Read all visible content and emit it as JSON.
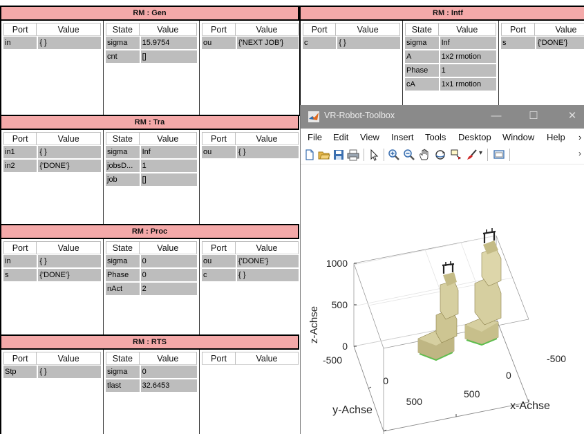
{
  "blocks": {
    "gen": {
      "title": "RM : Gen",
      "inputs": {
        "headers": [
          "Port",
          "Value"
        ],
        "rows": [
          [
            "in",
            "{ }"
          ]
        ]
      },
      "states": {
        "headers": [
          "State",
          "Value"
        ],
        "rows": [
          [
            "sigma",
            "15.9754"
          ],
          [
            "cnt",
            "[]"
          ]
        ]
      },
      "outputs": {
        "headers": [
          "Port",
          "Value"
        ],
        "rows": [
          [
            "ou",
            "{'NEXT JOB'}"
          ]
        ]
      }
    },
    "intf": {
      "title": "RM : Intf",
      "inputs": {
        "headers": [
          "Port",
          "Value"
        ],
        "rows": [
          [
            "c",
            "{ }"
          ]
        ]
      },
      "states": {
        "headers": [
          "State",
          "Value"
        ],
        "rows": [
          [
            "sigma",
            "Inf"
          ],
          [
            "A",
            "1x2 rmotion"
          ],
          [
            "Phase",
            "1"
          ],
          [
            "cA",
            "1x1 rmotion"
          ]
        ]
      },
      "outputs": {
        "headers": [
          "Port",
          "Value"
        ],
        "rows": [
          [
            "s",
            "{'DONE'}"
          ]
        ]
      }
    },
    "tra": {
      "title": "RM : Tra",
      "inputs": {
        "headers": [
          "Port",
          "Value"
        ],
        "rows": [
          [
            "in1",
            "{ }"
          ],
          [
            "in2",
            "{'DONE'}"
          ]
        ]
      },
      "states": {
        "headers": [
          "State",
          "Value"
        ],
        "rows": [
          [
            "sigma",
            "Inf"
          ],
          [
            "jobsD...",
            "1"
          ],
          [
            "job",
            "[]"
          ]
        ]
      },
      "outputs": {
        "headers": [
          "Port",
          "Value"
        ],
        "rows": [
          [
            "ou",
            "{ }"
          ]
        ]
      }
    },
    "proc": {
      "title": "RM : Proc",
      "inputs": {
        "headers": [
          "Port",
          "Value"
        ],
        "rows": [
          [
            "in",
            "{ }"
          ],
          [
            "s",
            "{'DONE'}"
          ]
        ]
      },
      "states": {
        "headers": [
          "State",
          "Value"
        ],
        "rows": [
          [
            "sigma",
            "0"
          ],
          [
            "Phase",
            "0"
          ],
          [
            "nAct",
            "2"
          ]
        ]
      },
      "outputs": {
        "headers": [
          "Port",
          "Value"
        ],
        "rows": [
          [
            "ou",
            "{'DONE'}"
          ],
          [
            "c",
            "{ }"
          ]
        ]
      }
    },
    "rts": {
      "title": "RM : RTS",
      "inputs": {
        "headers": [
          "Port",
          "Value"
        ],
        "rows": [
          [
            "Stp",
            "{ }"
          ]
        ]
      },
      "states": {
        "headers": [
          "State",
          "Value"
        ],
        "rows": [
          [
            "sigma",
            "0"
          ],
          [
            "tlast",
            "32.6453"
          ]
        ]
      },
      "outputs": {
        "headers": [
          "Port",
          "Value"
        ],
        "rows": []
      }
    }
  },
  "figure": {
    "title": "VR-Robot-Toolbox",
    "window_buttons": [
      "—",
      "☐",
      "✕"
    ],
    "menu": [
      "File",
      "Edit",
      "View",
      "Insert",
      "Tools",
      "Desktop",
      "Window",
      "Help"
    ],
    "toolbar_icons": [
      "new-figure-icon",
      "open-file-icon",
      "save-icon",
      "print-icon",
      "pointer-icon",
      "zoom-in-icon",
      "zoom-out-icon",
      "pan-icon",
      "rotate-3d-icon",
      "data-cursor-icon",
      "brush-icon",
      "link-plot-icon"
    ],
    "axes": {
      "z_label": "z-Achse",
      "y_label": "y-Achse",
      "x_label": "x-Achse",
      "z_ticks": [
        "0",
        "500",
        "1000"
      ],
      "y_ticks": [
        "-500",
        "0",
        "500"
      ],
      "x_ticks": [
        "-500",
        "0",
        "500"
      ]
    },
    "colors": {
      "robot": "#d6cfa0",
      "robot_shadow": "#a89d68",
      "gripper": "#222222",
      "base_accent": "#5fbf4f"
    }
  }
}
